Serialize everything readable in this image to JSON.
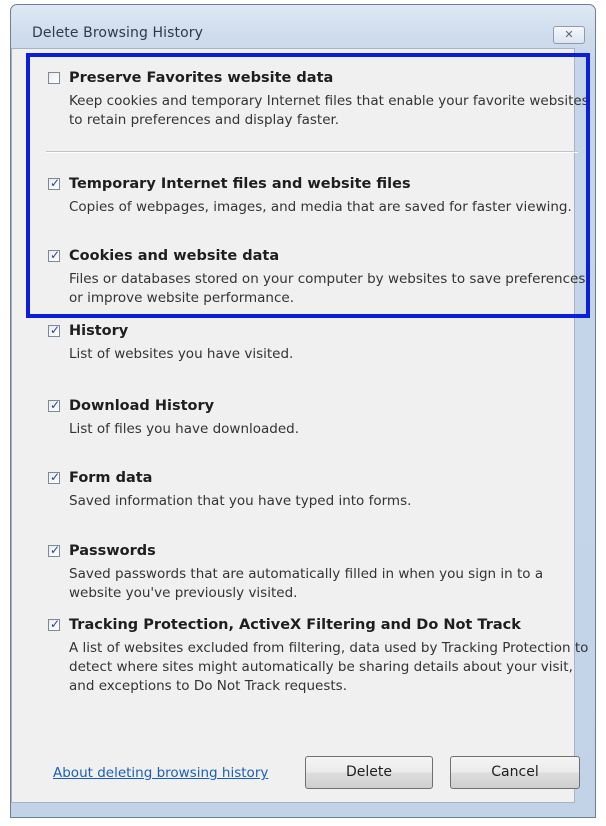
{
  "window": {
    "title": "Delete Browsing History",
    "close_glyph": "✕"
  },
  "colors": {
    "highlight_border": "#0b1fd8",
    "link": "#1a5eb8",
    "title_bar": "#c6d6ea"
  },
  "options": [
    {
      "id": "preserve-favorites",
      "label": "Preserve Favorites website data",
      "description": "Keep cookies and temporary Internet files that enable your favorite websites to retain preferences and display faster.",
      "checked": false
    },
    {
      "id": "temporary-files",
      "label": "Temporary Internet files and website files",
      "description": "Copies of webpages, images, and media that are saved for faster viewing.",
      "checked": true
    },
    {
      "id": "cookies",
      "label": "Cookies and website data",
      "description": "Files or databases stored on your computer by websites to save preferences or improve website performance.",
      "checked": true
    },
    {
      "id": "history",
      "label": "History",
      "description": "List of websites you have visited.",
      "checked": true
    },
    {
      "id": "download-history",
      "label": "Download History",
      "description": "List of files you have downloaded.",
      "checked": true
    },
    {
      "id": "form-data",
      "label": "Form data",
      "description": "Saved information that you have typed into forms.",
      "checked": true
    },
    {
      "id": "passwords",
      "label": "Passwords",
      "description": "Saved passwords that are automatically filled in when you sign in to a website you've previously visited.",
      "checked": true
    },
    {
      "id": "tracking-protection",
      "label": "Tracking Protection, ActiveX Filtering and Do Not Track",
      "description": "A list of websites excluded from filtering, data used by Tracking Protection to detect where sites might automatically be sharing details about your visit, and exceptions to Do Not Track requests.",
      "checked": true
    }
  ],
  "footer": {
    "help_link": "About deleting browsing history",
    "delete_label": "Delete",
    "cancel_label": "Cancel"
  },
  "check_glyph": "✓"
}
